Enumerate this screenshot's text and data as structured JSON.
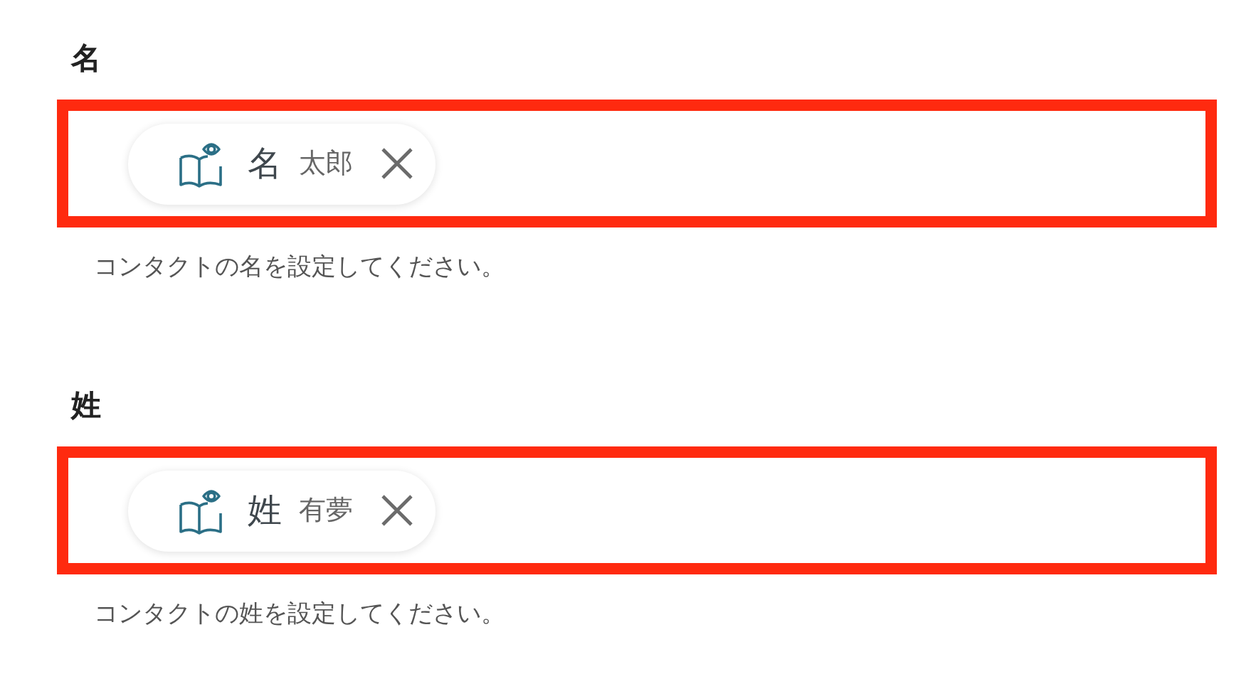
{
  "fields": [
    {
      "label": "名",
      "highlighted": true,
      "chip": {
        "name": "名",
        "value": "太郎",
        "removable": true
      },
      "help": "コンタクトの名を設定してください。"
    },
    {
      "label": "姓",
      "highlighted": true,
      "chip": {
        "name": "姓",
        "value": "有夢",
        "removable": true
      },
      "help": "コンタクトの姓を設定してください。"
    }
  ]
}
